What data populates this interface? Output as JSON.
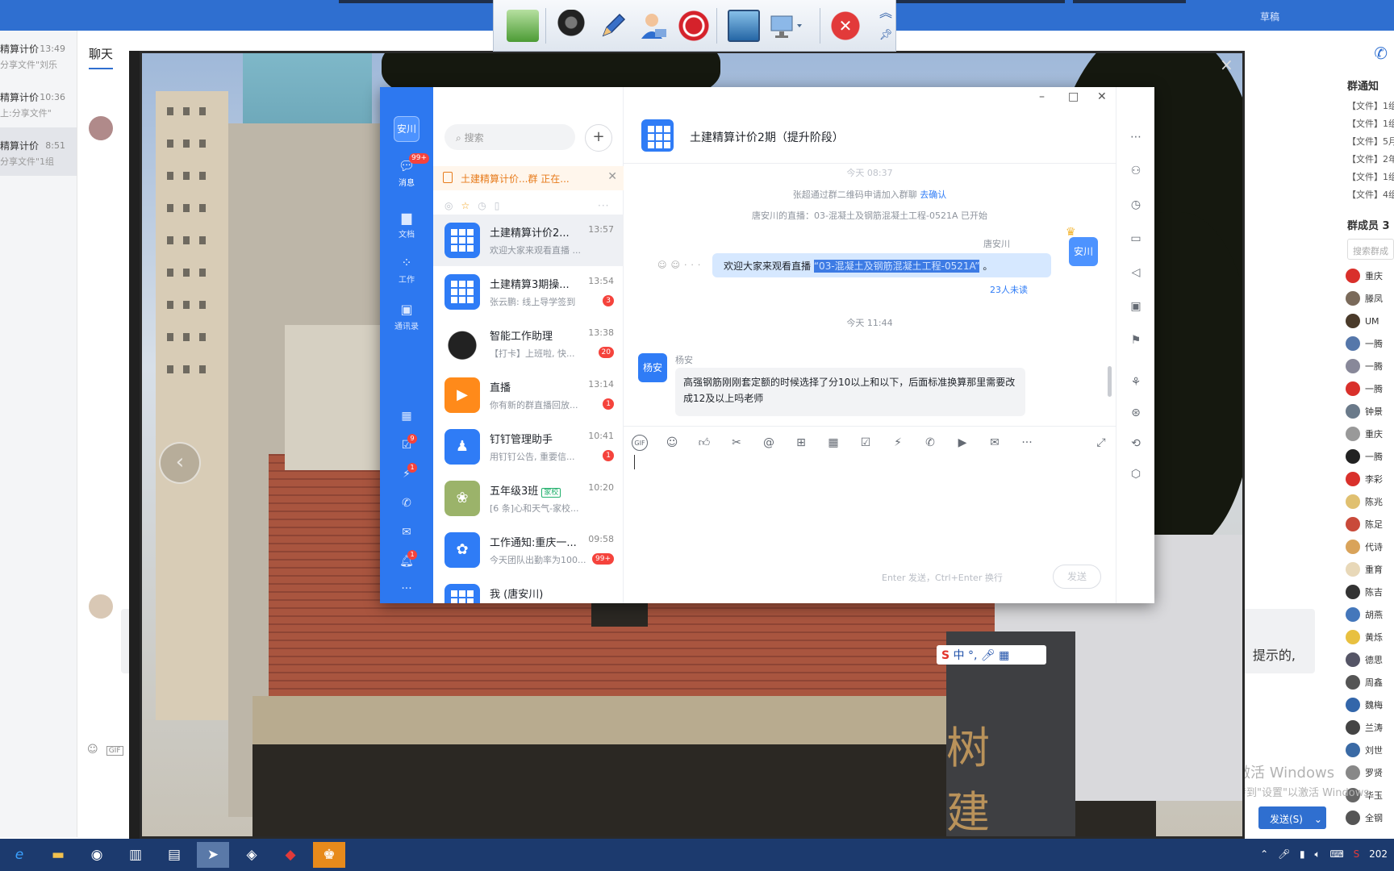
{
  "outer_app": {
    "topbar_right": "草稿",
    "tab_chat": "聊天",
    "conversations": [
      {
        "name": "精算计价",
        "time": "13:49",
        "preview": "分享文件\"刘乐"
      },
      {
        "name": "精算计价",
        "time": "10:36",
        "preview": "上:分享文件\""
      },
      {
        "name": "精算计价",
        "time": "8:51",
        "preview": "分享文件\"1组"
      }
    ],
    "bubble_tail": "提示的,",
    "send_button": "发送(S)",
    "watermark_title": "激活 Windows",
    "watermark_sub": "转到\"设置\"以激活 Windows",
    "right_panel": {
      "notice_header": "群通知",
      "notices": [
        "【文件】1组",
        "【文件】1组",
        "【文件】5月",
        "【文件】2年",
        "【文件】1组",
        "【文件】4组"
      ],
      "members_header": "群成员 3",
      "member_search": "搜索群成",
      "members": [
        {
          "name": "重庆",
          "color": "#d9302b"
        },
        {
          "name": "滕凤",
          "color": "#7a6a5a"
        },
        {
          "name": "UM",
          "color": "#4a3a2a"
        },
        {
          "name": "一腾",
          "color": "#5577aa"
        },
        {
          "name": "一腾",
          "color": "#889"
        },
        {
          "name": "一腾",
          "color": "#d9302b"
        },
        {
          "name": "钟景",
          "color": "#6a7a8a"
        },
        {
          "name": "重庆",
          "color": "#999"
        },
        {
          "name": "一腾",
          "color": "#222"
        },
        {
          "name": "李彩",
          "color": "#d9302b"
        },
        {
          "name": "陈兆",
          "color": "#e0c070"
        },
        {
          "name": "陈足",
          "color": "#c94a3a"
        },
        {
          "name": "代诗",
          "color": "#d9a35a"
        },
        {
          "name": "重育",
          "color": "#e8d8b8"
        },
        {
          "name": "陈吉",
          "color": "#333"
        },
        {
          "name": "胡燕",
          "color": "#4477bb"
        },
        {
          "name": "黄烁",
          "color": "#e8c040"
        },
        {
          "name": "德思",
          "color": "#556"
        },
        {
          "name": "周鑫",
          "color": "#555"
        },
        {
          "name": "魏梅",
          "color": "#3366aa"
        },
        {
          "name": "兰涛",
          "color": "#444"
        },
        {
          "name": "刘世",
          "color": "#3a6aa5"
        },
        {
          "name": "罗贤",
          "color": "#888"
        },
        {
          "name": "华玉",
          "color": "#666"
        },
        {
          "name": "全钢",
          "color": "#555"
        }
      ]
    }
  },
  "share_toolbar": {
    "close_glyph": "✕"
  },
  "viewer": {
    "close": "×",
    "prev": "‹",
    "gate_chars": [
      "树",
      "建"
    ]
  },
  "ime": {
    "logo": "S",
    "mode": "中"
  },
  "dingtalk": {
    "user_short": "安川",
    "nav": [
      {
        "label": "消息",
        "badge": "99+"
      },
      {
        "label": "文档",
        "badge": ""
      },
      {
        "label": "工作",
        "badge": ""
      },
      {
        "label": "通讯录",
        "badge": ""
      }
    ],
    "nav_small_badges": [
      "9",
      "1",
      "1"
    ],
    "search_placeholder": "搜索",
    "live_banner": "土建精算计价...群 正在...",
    "conversations": [
      {
        "name": "土建精算计价2...",
        "time": "13:57",
        "preview": "欢迎大家来观看直播 ...",
        "badge": "",
        "avatar": "grid"
      },
      {
        "name": "土建精算3期操...",
        "time": "13:54",
        "preview": "张云鹏: 线上导学签到",
        "badge": "3",
        "avatar": "grid"
      },
      {
        "name": "智能工作助理",
        "time": "13:38",
        "preview": "【打卡】上班啦, 快...",
        "badge": "20",
        "avatar": "bot"
      },
      {
        "name": "直播",
        "time": "13:14",
        "preview": "你有新的群直播回放...",
        "badge": "1",
        "avatar": "live"
      },
      {
        "name": "钉钉管理助手",
        "time": "10:41",
        "preview": "用钉钉公告, 重要信...",
        "badge": "1",
        "avatar": "manage"
      },
      {
        "name": "五年级3班",
        "time": "10:20",
        "preview": "[6 条]心和天气-家校...",
        "badge": "",
        "tag": "家校",
        "avatar": "class"
      },
      {
        "name": "工作通知:重庆一...",
        "time": "09:58",
        "preview": "今天团队出勤率为100...",
        "badge": "99+",
        "avatar": "notice"
      },
      {
        "name": "我 (唐安川)",
        "time": "",
        "preview": "",
        "badge": "",
        "avatar": "grid"
      }
    ],
    "chat": {
      "title": "土建精算计价2期（提升阶段）",
      "sys_top": "今天 08:37",
      "sys_join": "张超通过群二维码申请加入群聊",
      "sys_join_link": "去确认",
      "sys_live": "唐安川的直播：03-混凝土及钢筋混凝土工程-0521A 已开始",
      "me_name": "唐安川",
      "me_msg_prefix": "欢迎大家来观看直播",
      "me_msg_highlight": "“03-混凝土及钢筋混凝土工程-0521A”",
      "me_msg_suffix": "。",
      "unread": "23人未读",
      "time_sep": "今天 11:44",
      "other_name": "杨安",
      "other_msg": "高强钢筋刚刚套定额的时候选择了分10以上和以下，后面标准换算那里需要改成12及以上吗老师",
      "send_hint": "Enter 发送，Ctrl+Enter 换行",
      "send_label": "发送"
    }
  },
  "taskbar": {
    "tray_text": "202"
  }
}
